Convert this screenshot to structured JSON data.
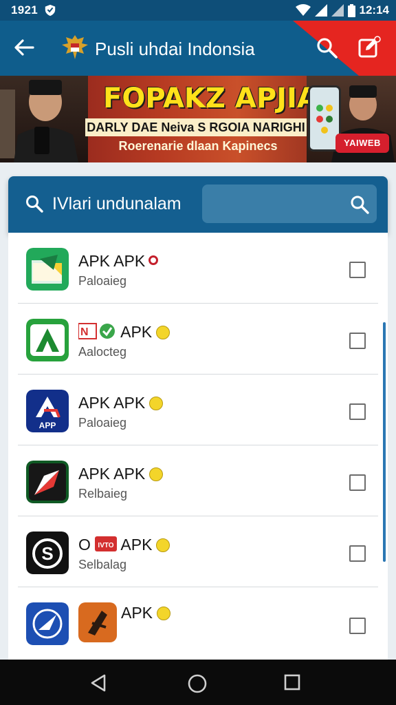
{
  "status_bar": {
    "time_left": "1921",
    "time_right": "12:14",
    "icons": [
      "shield-icon",
      "wifi-icon",
      "signal-icon",
      "signal-icon",
      "battery-icon"
    ]
  },
  "app_bar": {
    "title": "Pusli uhdai Indonsia",
    "back_icon": "arrow-left-icon",
    "logo_icon": "garuda-emblem-icon",
    "search_icon": "search-icon",
    "edit_icon": "edit-icon",
    "colors": {
      "bar": "#0f5d8c",
      "accent": "#e52520"
    }
  },
  "banner": {
    "headline": "FOPAKZ APJIAN",
    "line1": "DARLY DAE Neiva S RGOIA NARIGHI",
    "line2": "Roerenarie dlaan Kapinecs",
    "badge": "YAIWEB"
  },
  "search": {
    "label": "IVlari undunalam",
    "icon": "search-icon",
    "input_placeholder": "",
    "input_icon": "search-icon"
  },
  "apps": [
    {
      "title_parts": [
        "APK",
        "APK"
      ],
      "badge": "red",
      "subtitle": "Paloaieg",
      "icon": "app-icon-green-folder"
    },
    {
      "title_parts": [
        "",
        "APK"
      ],
      "badge": "yellow",
      "subtitle": "Aalocteg",
      "icon": "app-icon-green-a"
    },
    {
      "title_parts": [
        "APK",
        "APK"
      ],
      "badge": "yellow",
      "subtitle": "Paloaieg",
      "icon": "app-icon-blue-app"
    },
    {
      "title_parts": [
        "APK",
        "APK"
      ],
      "badge": "yellow",
      "subtitle": "Relbaieg",
      "icon": "app-icon-red-arrow"
    },
    {
      "title_parts": [
        "O",
        "APK"
      ],
      "badge": "yellow",
      "subtitle": "Selbalag",
      "icon": "app-icon-s-circle"
    },
    {
      "title_parts": [
        "",
        "APK"
      ],
      "badge": "yellow",
      "subtitle": "",
      "icon": "app-icon-blue-compass"
    }
  ],
  "row_small_labels": {
    "row5_tag": "IVTO",
    "row3_tag": "APP"
  },
  "navigation": {
    "back": "nav-back-icon",
    "home": "nav-home-icon",
    "recents": "nav-recents-icon"
  }
}
